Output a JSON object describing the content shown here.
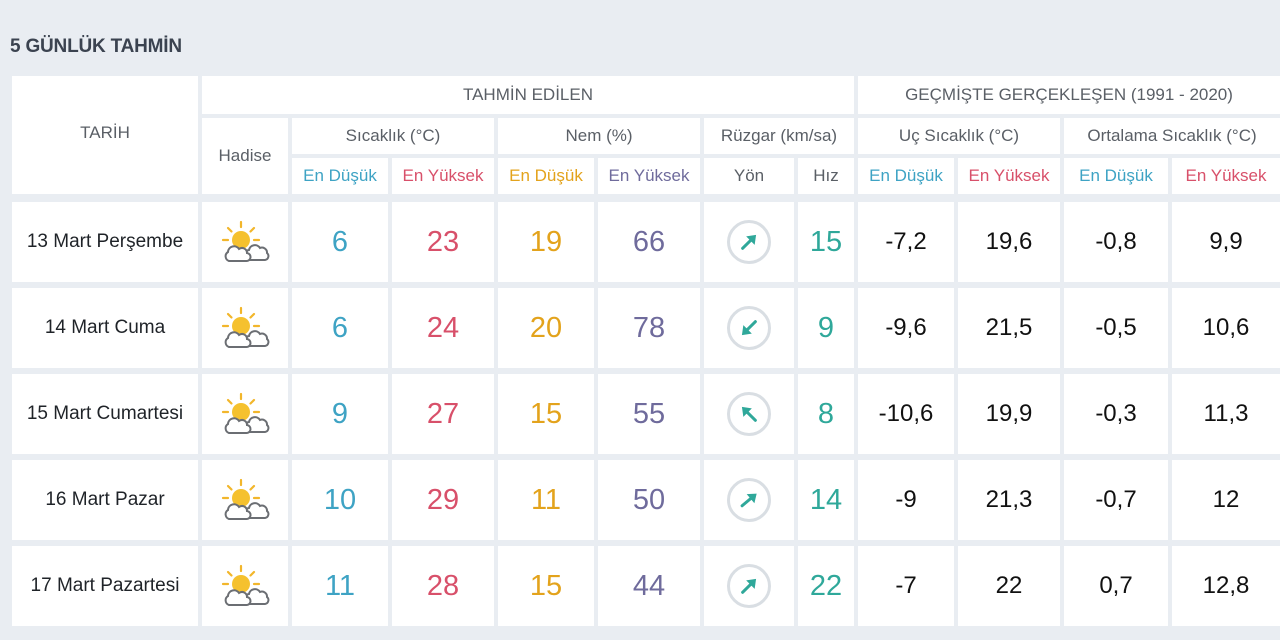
{
  "page": {
    "title": "5 GÜNLÜK TAHMİN"
  },
  "header": {
    "tarih": "TARİH",
    "hadise": "Hadise",
    "tahmin_edilen": "TAHMİN EDİLEN",
    "gecmiste": "GEÇMİŞTE GERÇEKLEŞEN (1991 - 2020)",
    "sicaklik": "Sıcaklık (°C)",
    "nem": "Nem (%)",
    "ruzgar": "Rüzgar (km/sa)",
    "uc_sicaklik": "Uç Sıcaklık (°C)",
    "ortalama_sicaklik": "Ortalama Sıcaklık (°C)",
    "en_dusuk": "En Düşük",
    "en_yuksek": "En Yüksek",
    "yon": "Yön",
    "hiz": "Hız"
  },
  "colors": {
    "blue": "#3ea3c4",
    "red": "#d8506a",
    "orange": "#e3a31c",
    "purple": "#6f6b9c",
    "teal": "#2fa89a"
  },
  "rows": [
    {
      "date": "13 Mart Perşembe",
      "icon": "partly-cloudy-icon",
      "temp_min": "6",
      "temp_max": "23",
      "hum_min": "19",
      "hum_max": "66",
      "wind_dir_deg": 45,
      "wind_speed": "15",
      "rec_min": "-7,2",
      "rec_max": "19,6",
      "avg_min": "-0,8",
      "avg_max": "9,9"
    },
    {
      "date": "14 Mart Cuma",
      "icon": "partly-cloudy-icon",
      "temp_min": "6",
      "temp_max": "24",
      "hum_min": "20",
      "hum_max": "78",
      "wind_dir_deg": 225,
      "wind_speed": "9",
      "rec_min": "-9,6",
      "rec_max": "21,5",
      "avg_min": "-0,5",
      "avg_max": "10,6"
    },
    {
      "date": "15 Mart Cumartesi",
      "icon": "partly-cloudy-icon",
      "temp_min": "9",
      "temp_max": "27",
      "hum_min": "15",
      "hum_max": "55",
      "wind_dir_deg": 315,
      "wind_speed": "8",
      "rec_min": "-10,6",
      "rec_max": "19,9",
      "avg_min": "-0,3",
      "avg_max": "11,3"
    },
    {
      "date": "16 Mart Pazar",
      "icon": "partly-cloudy-icon",
      "temp_min": "10",
      "temp_max": "29",
      "hum_min": "11",
      "hum_max": "50",
      "wind_dir_deg": 50,
      "wind_speed": "14",
      "rec_min": "-9",
      "rec_max": "21,3",
      "avg_min": "-0,7",
      "avg_max": "12"
    },
    {
      "date": "17 Mart Pazartesi",
      "icon": "partly-cloudy-icon",
      "temp_min": "11",
      "temp_max": "28",
      "hum_min": "15",
      "hum_max": "44",
      "wind_dir_deg": 45,
      "wind_speed": "22",
      "rec_min": "-7",
      "rec_max": "22",
      "avg_min": "0,7",
      "avg_max": "12,8"
    }
  ]
}
